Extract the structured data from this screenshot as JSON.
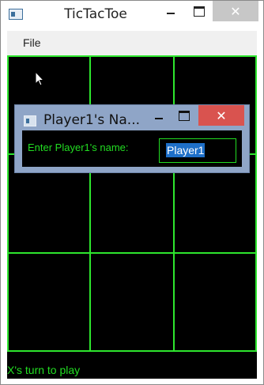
{
  "window": {
    "title": "TicTacToe",
    "close_symbol": "✕"
  },
  "menu": {
    "items": [
      {
        "label": "File"
      }
    ]
  },
  "board": {
    "rows": 3,
    "cols": 3,
    "cells": [
      "",
      "",
      "",
      "",
      "",
      "",
      "",
      "",
      ""
    ],
    "background": "#000000",
    "line_color": "#2ee62e"
  },
  "status": {
    "text": "X's turn to play",
    "color": "#22dd22"
  },
  "dialog": {
    "title": "Player1's Na...",
    "close_symbol": "✕",
    "prompt_label": "Enter Player1's name:",
    "input_value": "Player1",
    "close_color": "#d9534f"
  }
}
